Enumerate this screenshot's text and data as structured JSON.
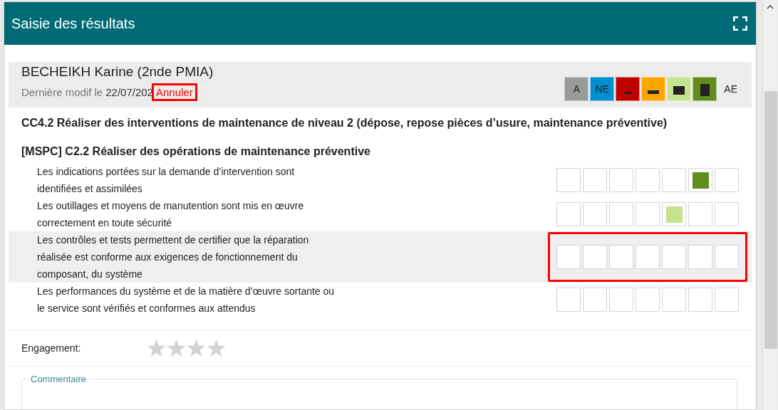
{
  "dialog": {
    "title": "Saisie des résultats"
  },
  "student": {
    "name": "BECHEIKH Karine (2nde PMIA)",
    "modified_label": "Dernière modif le",
    "modified_date": "22/07/202",
    "cancel": {
      "label": "Annuler",
      "annotated": true
    }
  },
  "legend": [
    {
      "kind": "text",
      "label": "A",
      "color": "#999999"
    },
    {
      "kind": "text",
      "label": "NE",
      "color": "#0090d0"
    },
    {
      "kind": "dash",
      "color": "#c00000"
    },
    {
      "kind": "bar",
      "color": "#ffa500"
    },
    {
      "kind": "square",
      "color": "#c5e38f"
    },
    {
      "kind": "block",
      "color": "#638c1e"
    },
    {
      "kind": "plain",
      "label": "AE"
    }
  ],
  "competency": "CC4.2 Réaliser des interventions de maintenance de niveau 2 (dépose, repose pièces d’usure, maintenance préventive)",
  "skill": "[MSPC] C2.2 Réaliser des opérations de maintenance préventive",
  "criteria": [
    {
      "text": "Les indications portées sur la demande d’intervention sont\nidentifiées et assimilées",
      "highlighted": false,
      "annotated": false,
      "boxes": [
        {
          "selected": false
        },
        {
          "selected": false
        },
        {
          "selected": false
        },
        {
          "selected": false
        },
        {
          "selected": false
        },
        {
          "selected": true
        },
        {
          "selected": false
        }
      ]
    },
    {
      "text": "Les outillages et moyens de manutention sont mis en œuvre\ncorrectement en toute sécurité",
      "highlighted": false,
      "annotated": false,
      "boxes": [
        {
          "selected": false
        },
        {
          "selected": false
        },
        {
          "selected": false
        },
        {
          "selected": false
        },
        {
          "selected": true
        },
        {
          "selected": false
        },
        {
          "selected": false
        }
      ]
    },
    {
      "text": "Les contrôles et tests permettent de certifier que la réparation\nréalisée est conforme aux exigences de fonctionnement du\ncomposant, du système",
      "highlighted": true,
      "annotated": true,
      "boxes": [
        {
          "selected": false
        },
        {
          "selected": false
        },
        {
          "selected": false
        },
        {
          "selected": false
        },
        {
          "selected": false
        },
        {
          "selected": false
        },
        {
          "selected": false
        }
      ]
    },
    {
      "text": "Les performances du système et de la matière d’œuvre sortante ou\nle service sont vérifiés et conformes aux attendus",
      "highlighted": false,
      "annotated": false,
      "boxes": [
        {
          "selected": false
        },
        {
          "selected": false
        },
        {
          "selected": false
        },
        {
          "selected": false
        },
        {
          "selected": false
        },
        {
          "selected": false
        },
        {
          "selected": false
        }
      ]
    }
  ],
  "engagement": {
    "label": "Engagement:",
    "stars": 0
  },
  "comment": {
    "legend": "Commentaire"
  }
}
